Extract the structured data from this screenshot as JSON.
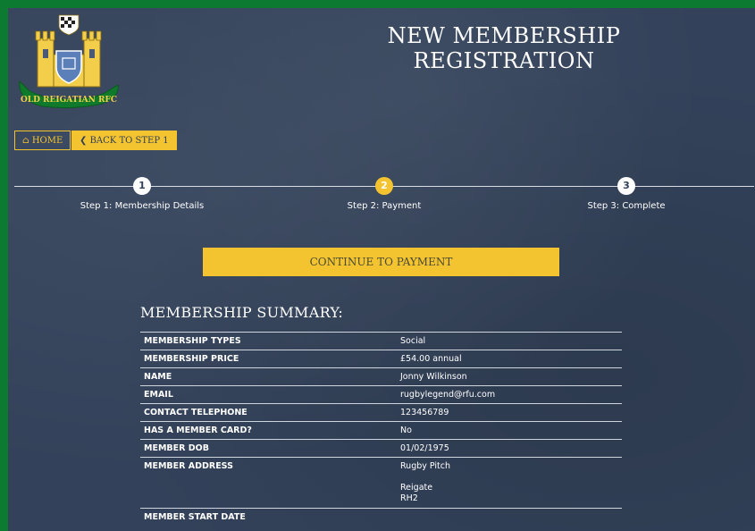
{
  "page": {
    "title": "NEW MEMBERSHIP REGISTRATION"
  },
  "logo": {
    "text": "OLD REIGATIAN RFC"
  },
  "nav": {
    "home_label": "HOME",
    "back_label": "BACK TO STEP 1"
  },
  "steps": [
    {
      "number": "1",
      "label": "Step 1: Membership Details",
      "active": false
    },
    {
      "number": "2",
      "label": "Step 2: Payment",
      "active": true
    },
    {
      "number": "3",
      "label": "Step 3: Complete",
      "active": false
    }
  ],
  "continue_label": "CONTINUE TO PAYMENT",
  "summary": {
    "title": "MEMBERSHIP SUMMARY:",
    "rows": [
      {
        "label": "MEMBERSHIP TYPES",
        "value": "Social"
      },
      {
        "label": "MEMBERSHIP PRICE",
        "value": "£54.00 annual"
      },
      {
        "label": "NAME",
        "value": "Jonny Wilkinson"
      },
      {
        "label": "EMAIL",
        "value": "rugbylegend@rfu.com"
      },
      {
        "label": "CONTACT TELEPHONE",
        "value": "123456789"
      },
      {
        "label": "HAS A MEMBER CARD?",
        "value": "No"
      },
      {
        "label": "MEMBER DOB",
        "value": "01/02/1975"
      }
    ],
    "address": {
      "label": "MEMBER ADDRESS",
      "line1": "Rugby Pitch",
      "line2": "Reigate",
      "line3": "RH2"
    },
    "start_date_label": "MEMBER START DATE"
  },
  "colors": {
    "accent": "#f4c430",
    "panel": "#33425a",
    "frame": "#0d7a32"
  }
}
